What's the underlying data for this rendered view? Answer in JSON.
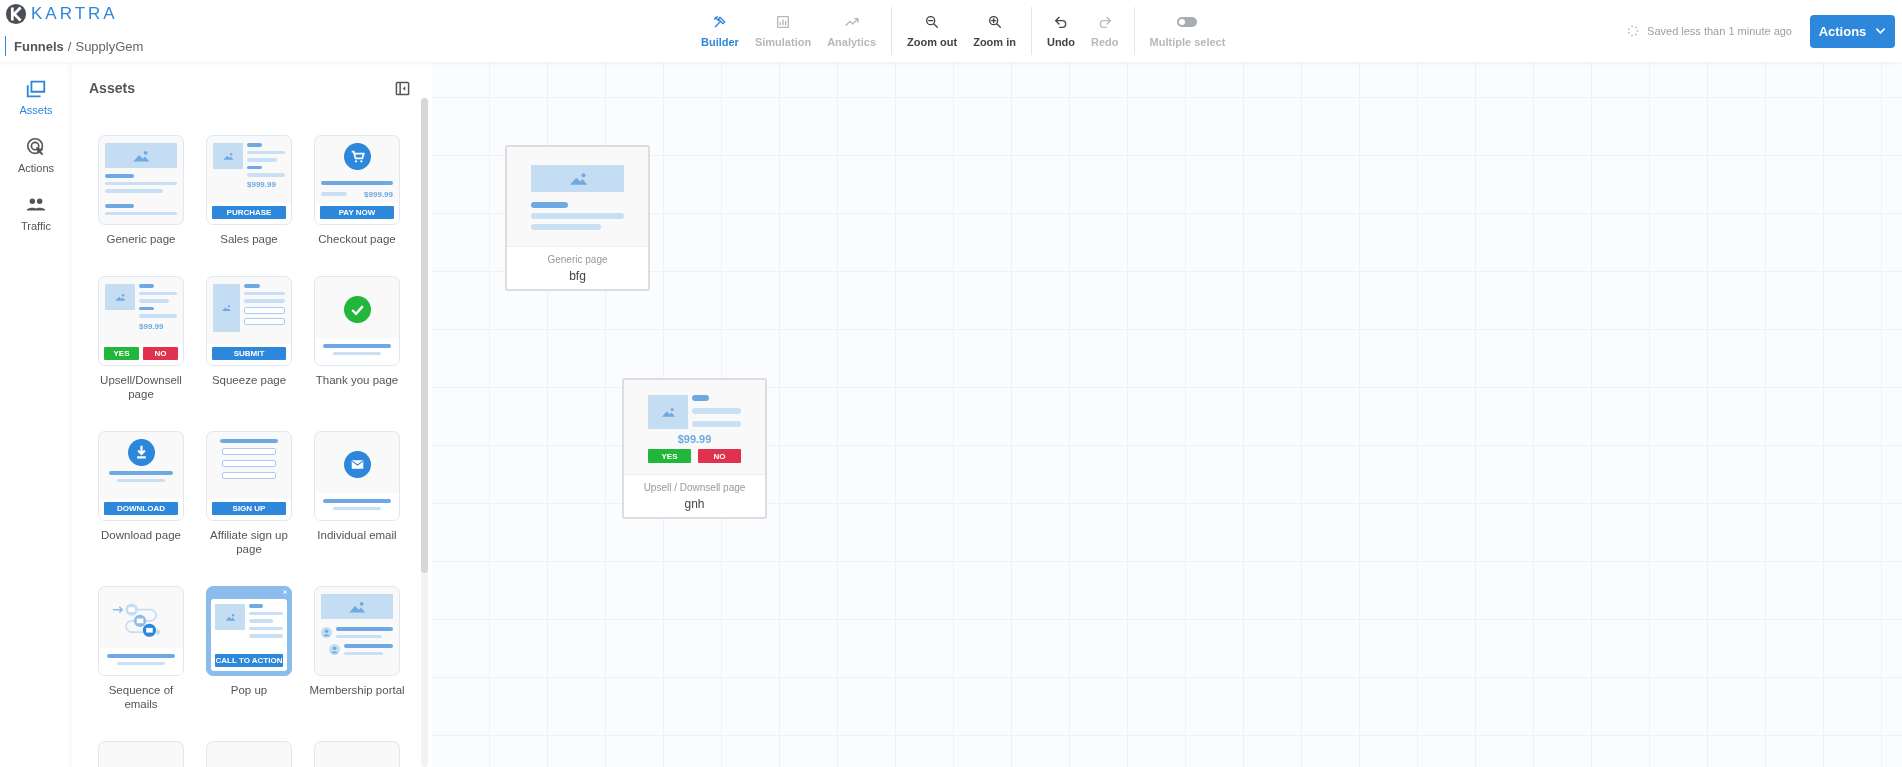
{
  "logo": {
    "wordmark": "KARTRA"
  },
  "breadcrumb": {
    "parent": "Funnels",
    "separator": "/",
    "current": "SupplyGem"
  },
  "toolbar": {
    "groups": [
      {
        "items": [
          {
            "kind": "tab",
            "label": "Builder",
            "selected": true,
            "disabled": false
          },
          {
            "kind": "tab",
            "label": "Simulation",
            "selected": false,
            "disabled": true
          },
          {
            "kind": "tab",
            "label": "Analytics",
            "selected": false,
            "disabled": true
          }
        ]
      },
      {
        "items": [
          {
            "kind": "button",
            "label": "Zoom out",
            "disabled": false
          },
          {
            "kind": "button",
            "label": "Zoom in",
            "disabled": false
          }
        ]
      },
      {
        "items": [
          {
            "kind": "button",
            "label": "Undo",
            "disabled": false
          },
          {
            "kind": "button",
            "label": "Redo",
            "disabled": true
          }
        ]
      },
      {
        "items": [
          {
            "kind": "toggle",
            "label": "Multiple select",
            "on": false,
            "disabled": true
          }
        ]
      }
    ]
  },
  "save_status": "Saved less than 1 minute ago",
  "actions_button": "Actions",
  "rail": [
    {
      "label": "Assets",
      "selected": true
    },
    {
      "label": "Actions",
      "selected": false
    },
    {
      "label": "Traffic",
      "selected": false
    }
  ],
  "assets_panel": {
    "title": "Assets",
    "items": [
      {
        "kind": "generic",
        "label": "Generic page"
      },
      {
        "kind": "sales",
        "label": "Sales page",
        "price": "$999.99",
        "buttons": [
          {
            "label": "PURCHASE"
          }
        ]
      },
      {
        "kind": "checkout",
        "label": "Checkout page",
        "price": "$999.99",
        "buttons": [
          {
            "label": "PAY NOW"
          }
        ]
      },
      {
        "kind": "upsell",
        "label": "Upsell/Downsell page",
        "price": "$99.99",
        "buttons": [
          {
            "label": "YES",
            "color": "#22b63a"
          },
          {
            "label": "NO",
            "color": "#e0314f"
          }
        ]
      },
      {
        "kind": "squeeze",
        "label": "Squeeze page",
        "buttons": [
          {
            "label": "SUBMIT"
          }
        ]
      },
      {
        "kind": "thankyou",
        "label": "Thank you page"
      },
      {
        "kind": "download",
        "label": "Download page",
        "buttons": [
          {
            "label": "DOWNLOAD"
          }
        ]
      },
      {
        "kind": "affiliate",
        "label": "Affiliate sign up page",
        "buttons": [
          {
            "label": "SIGN UP"
          }
        ]
      },
      {
        "kind": "email",
        "label": "Individual email"
      },
      {
        "kind": "sequence",
        "label": "Sequence of emails"
      },
      {
        "kind": "popup",
        "label": "Pop up",
        "buttons": [
          {
            "label": "CALL TO ACTION"
          }
        ]
      },
      {
        "kind": "membership",
        "label": "Membership portal"
      },
      {
        "kind": "clipped"
      },
      {
        "kind": "clipped"
      },
      {
        "kind": "clipped"
      }
    ]
  },
  "canvas": {
    "nodes": [
      {
        "kind": "generic",
        "type_label": "Generic page",
        "name": "bfg"
      },
      {
        "kind": "upsell",
        "type_label": "Upsell / Downsell page",
        "name": "gnh",
        "price": "$99.99",
        "buttons": [
          {
            "label": "YES",
            "color": "#22b63a"
          },
          {
            "label": "NO",
            "color": "#e0314f"
          }
        ]
      }
    ]
  }
}
